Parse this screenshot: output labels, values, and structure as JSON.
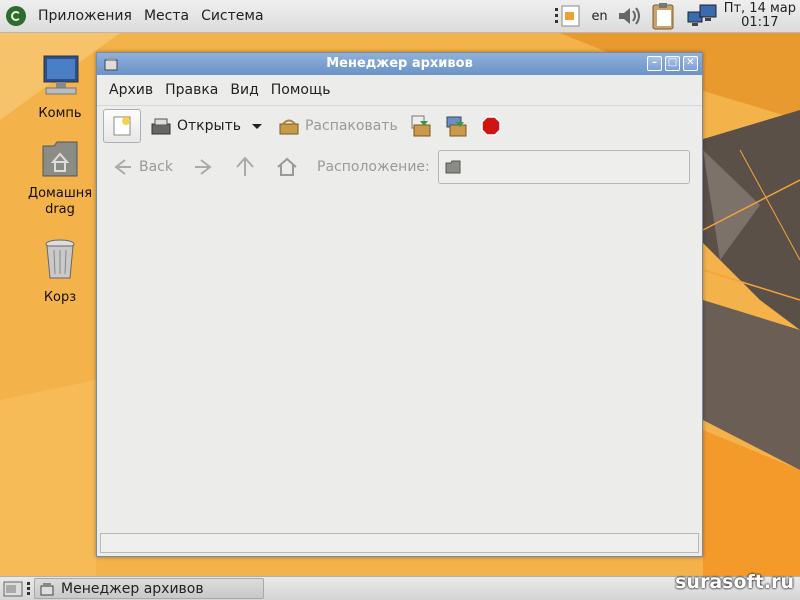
{
  "top_panel": {
    "menus": [
      "Приложения",
      "Места",
      "Система"
    ],
    "keyboard_layout": "en",
    "clock": {
      "date": "Пт, 14 мар",
      "time": "01:17"
    }
  },
  "desktop": {
    "icons": [
      {
        "name": "computer",
        "label": "Компь"
      },
      {
        "name": "home",
        "label_line1": "Домашня",
        "label_line2": "drag"
      },
      {
        "name": "trash",
        "label": "Корз"
      }
    ]
  },
  "window": {
    "title": "Менеджер архивов",
    "menu": [
      "Архив",
      "Правка",
      "Вид",
      "Помощь"
    ],
    "toolbar": {
      "open_label": "Открыть",
      "extract_label": "Распаковать"
    },
    "location": {
      "back_label": "Back",
      "location_label": "Расположение:"
    }
  },
  "taskbar": {
    "task_label": "Менеджер архивов",
    "watermark": "surasoft.ru"
  },
  "colors": {
    "wallpaper_orange": "#f2a93b",
    "titlebar_blue": "#7aa0d3",
    "stop_red": "#d01414"
  }
}
